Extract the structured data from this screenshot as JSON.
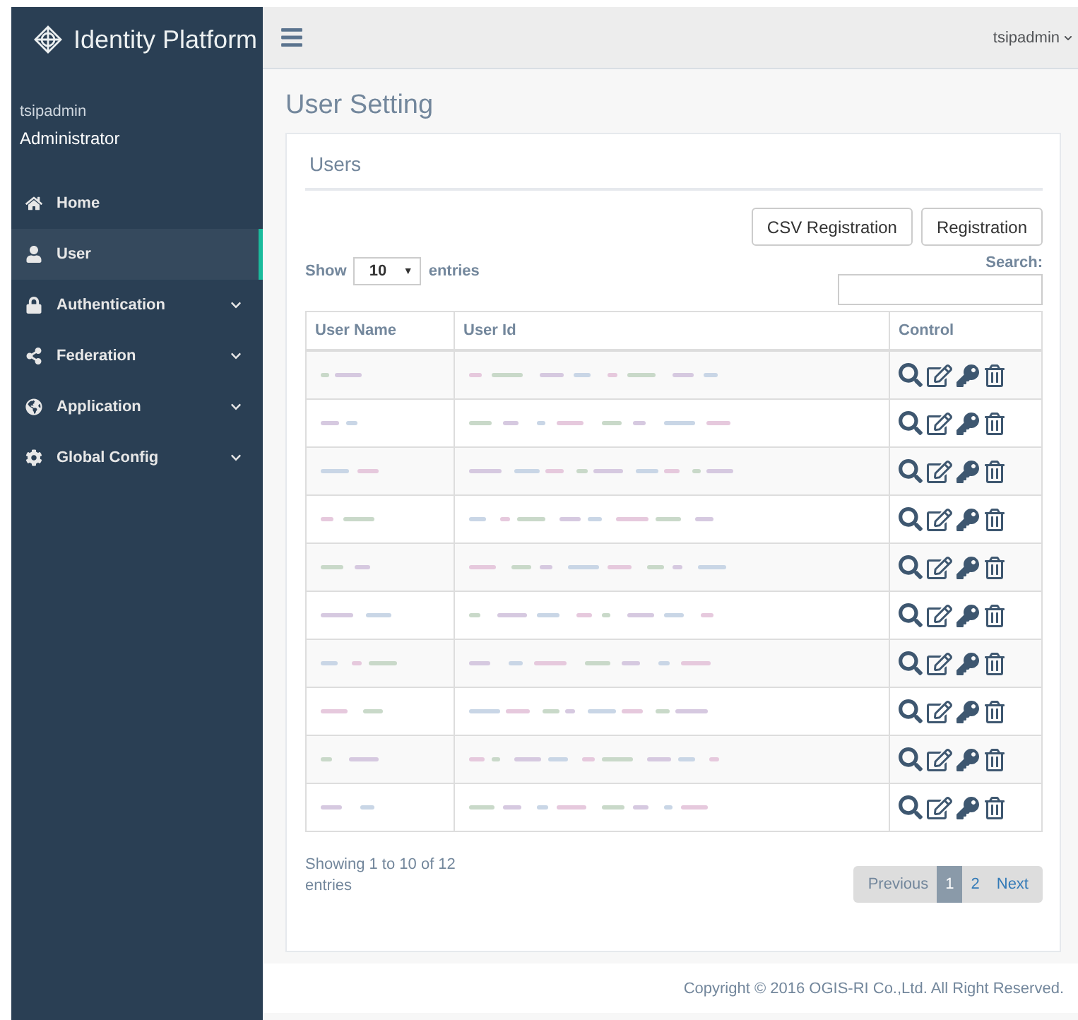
{
  "sidebar": {
    "brand": "Identity Platform",
    "user": {
      "name": "tsipadmin",
      "role": "Administrator"
    },
    "items": [
      {
        "label": "Home",
        "selected": false,
        "expandable": false
      },
      {
        "label": "User",
        "selected": true,
        "expandable": false
      },
      {
        "label": "Authentication",
        "selected": false,
        "expandable": true
      },
      {
        "label": "Federation",
        "selected": false,
        "expandable": true
      },
      {
        "label": "Application",
        "selected": false,
        "expandable": true
      },
      {
        "label": "Global Config",
        "selected": false,
        "expandable": true
      }
    ]
  },
  "topbar": {
    "user_menu": "tsipadmin"
  },
  "page_title": "User Setting",
  "panel": {
    "title": "Users",
    "buttons": [
      "CSV Registration",
      "Registration"
    ],
    "length": {
      "prefix": "Show",
      "value": "10",
      "caret": "▼",
      "suffix": "entries"
    },
    "search": {
      "label": "Search:"
    },
    "table": {
      "columns": [
        "User Name",
        "User Id",
        "Control"
      ],
      "rows": [
        {
          "kind": "blurred"
        },
        {
          "kind": "blurred"
        },
        {
          "kind": "blurred"
        },
        {
          "kind": "blurred"
        },
        {
          "kind": "blurred"
        },
        {
          "kind": "blurred"
        },
        {
          "kind": "blurred"
        },
        {
          "kind": "blurred"
        },
        {
          "kind": "blurred"
        },
        {
          "kind": "blurred"
        }
      ]
    },
    "info": "Showing 1 to 10 of 12 entries",
    "pagination": [
      {
        "label": "Previous",
        "kind": "prev",
        "selected": false
      },
      {
        "label": "1",
        "kind": "page",
        "selected": true
      },
      {
        "label": "2",
        "kind": "page",
        "selected": false
      },
      {
        "label": "Next",
        "kind": "next",
        "selected": false
      }
    ]
  },
  "footer": "Copyright © 2016 OGIS-RI Co.,Ltd. All Right Reserved."
}
